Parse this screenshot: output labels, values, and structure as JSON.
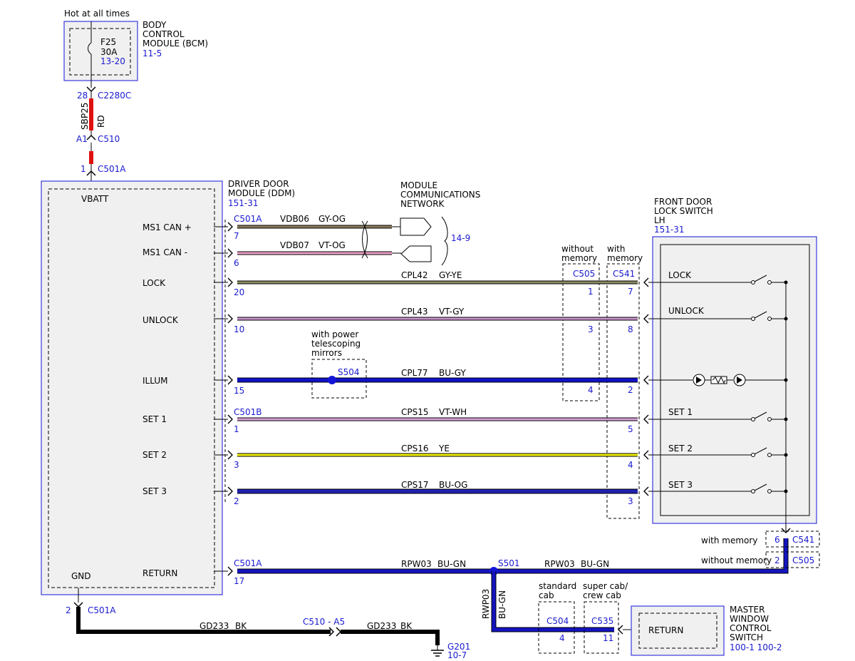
{
  "colors": {
    "ref_text": "#1a1ad0",
    "module_border": "#3a3ae0",
    "module_fill": "#f0f0f0",
    "sbp25_wire": "#e01010",
    "gy_og": "#8a7a5e",
    "vt_og": "#f0a0c8",
    "gy_ye": "#8c8a62",
    "vt_gy": "#c892c8",
    "bu_gy": "#1010c8",
    "vt_wh": "#d8a0d8",
    "ye": "#f0f000",
    "bu_og": "#2020b0",
    "bu_gn": "#1414c0",
    "bk": "#000000"
  },
  "bcm": {
    "top_label": "Hot at all times",
    "name_line1": "BODY",
    "name_line2": "CONTROL",
    "name_line3": "MODULE (BCM)",
    "ref": "11-5",
    "fuse_name": "F25",
    "fuse_rating": "30A",
    "fuse_ref": "13-20"
  },
  "feed": {
    "pin_top": "28",
    "conn_top": "C2280C",
    "circuit": "SBP25",
    "color": "RD",
    "pin_mid": "A1",
    "conn_mid": "C510",
    "pin_bot": "1",
    "conn_bot": "C501A"
  },
  "ddm": {
    "name_line1": "DRIVER DOOR",
    "name_line2": "MODULE (DDM)",
    "ref": "151-31",
    "vbatt": "VBATT",
    "gnd": "GND",
    "pins": {
      "ms1_can_plus": "MS1 CAN +",
      "ms1_can_minus": "MS1 CAN -",
      "lock": "LOCK",
      "unlock": "UNLOCK",
      "illum": "ILLUM",
      "set1": "SET 1",
      "set2": "SET 2",
      "set3": "SET 3",
      "return": "RETURN"
    }
  },
  "network": {
    "line1": "MODULE",
    "line2": "COMMUNICATIONS",
    "line3": "NETWORK",
    "ref": "14-9"
  },
  "circuits": {
    "vdb06": {
      "conn": "C501A",
      "pin": "7",
      "name": "VDB06",
      "color": "GY-OG"
    },
    "vdb07": {
      "pin": "6",
      "name": "VDB07",
      "color": "VT-OG"
    },
    "cpl42": {
      "pin": "20",
      "name": "CPL42",
      "color": "GY-YE",
      "c505_pin": "1",
      "c541_pin": "7"
    },
    "cpl43": {
      "pin": "10",
      "name": "CPL43",
      "color": "VT-GY",
      "c505_pin": "3",
      "c541_pin": "8"
    },
    "cpl77": {
      "pin": "15",
      "name": "CPL77",
      "color": "BU-GY",
      "c505_pin": "4",
      "c541_pin": "2",
      "splice": "S504"
    },
    "cps15": {
      "conn": "C501B",
      "pin": "1",
      "name": "CPS15",
      "color": "VT-WH",
      "c541_pin": "5"
    },
    "cps16": {
      "pin": "3",
      "name": "CPS16",
      "color": "YE",
      "c541_pin": "4"
    },
    "cps17": {
      "pin": "2",
      "name": "CPS17",
      "color": "BU-OG",
      "c541_pin": "3"
    },
    "rpw03": {
      "conn": "C501A",
      "pin": "17",
      "name": "RPW03",
      "color": "BU-GN",
      "splice": "S501"
    }
  },
  "mirrors_option": {
    "line1": "with power",
    "line2": "telescoping",
    "line3": "mirrors"
  },
  "c505_option": {
    "line1": "without",
    "line2": "memory",
    "conn": "C505"
  },
  "c541_option": {
    "line1": "with",
    "line2": "memory",
    "conn": "C541"
  },
  "lock_switch": {
    "name_line1": "FRONT DOOR",
    "name_line2": "LOCK SWITCH",
    "name_line3": "LH",
    "ref": "151-31",
    "lock": "LOCK",
    "unlock": "UNLOCK",
    "set1": "SET 1",
    "set2": "SET 2",
    "set3": "SET 3"
  },
  "return_conns": {
    "with_memory": "with memory",
    "with_memory_pin": "6",
    "with_memory_conn": "C541",
    "without_memory": "without memory",
    "without_memory_pin": "2",
    "without_memory_conn": "C505"
  },
  "branch": {
    "circuit": "RWP03",
    "color": "BU-GN",
    "standard_line1": "standard",
    "standard_line2": "cab",
    "standard_conn": "C504",
    "standard_pin": "4",
    "crew_line1": "super cab/",
    "crew_line2": "crew cab",
    "crew_conn": "C535",
    "crew_pin": "11"
  },
  "mwcs": {
    "return": "RETURN",
    "name_line1": "MASTER",
    "name_line2": "WINDOW",
    "name_line3": "CONTROL",
    "name_line4": "SWITCH",
    "ref": "100-1 100-2"
  },
  "ground": {
    "pin": "2",
    "conn": "C501A",
    "circuit": "GD233",
    "color": "BK",
    "inline_conn": "C510 - A5",
    "ground_name": "G201",
    "ground_ref": "10-7"
  }
}
